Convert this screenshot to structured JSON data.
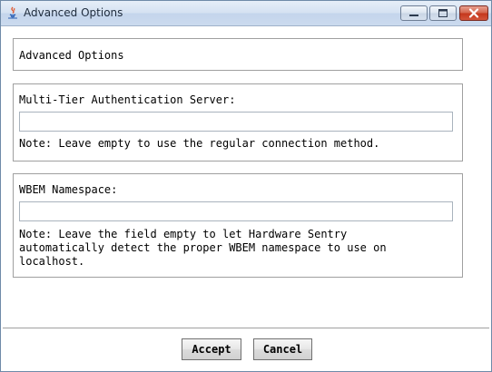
{
  "window": {
    "title": "Advanced Options"
  },
  "header": {
    "title": "Advanced Options"
  },
  "mtas": {
    "label": "Multi-Tier Authentication Server:",
    "value": "",
    "note": "Note: Leave empty to use the regular connection method."
  },
  "wbem": {
    "label": "WBEM Namespace:",
    "value": "",
    "note": "Note: Leave the field empty to let Hardware Sentry\nautomatically detect the proper WBEM namespace to use on\nlocalhost."
  },
  "buttons": {
    "accept": "Accept",
    "cancel": "Cancel"
  },
  "icons": {
    "app": "java-app-icon",
    "minimize": "minimize-icon",
    "maximize": "maximize-icon",
    "close": "close-icon"
  },
  "colors": {
    "titlebar": "#d5e2f2",
    "close_button": "#c4361c",
    "panel_border": "#a0a0a0"
  }
}
